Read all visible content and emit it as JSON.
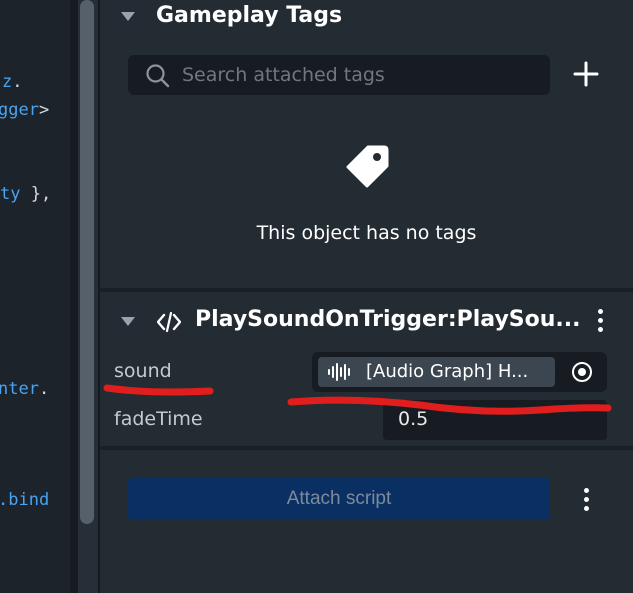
{
  "code": {
    "lines": [
      {
        "blue": "z",
        "white": "."
      },
      {
        "blue": "gger",
        "white": ">"
      },
      {
        "blue": "ty",
        "white": " },"
      },
      {
        "blue": "nter",
        "white": "."
      },
      {
        "blue": ".bind",
        "white": ""
      }
    ]
  },
  "gameplay_tags": {
    "title": "Gameplay Tags",
    "search_placeholder": "Search attached tags",
    "empty_message": "This object has no tags"
  },
  "component": {
    "title": "PlaySoundOnTrigger:PlaySou...",
    "properties": [
      {
        "label": "sound",
        "value": "[Audio Graph] H..."
      },
      {
        "label": "fadeTime",
        "value": "0.5"
      }
    ]
  },
  "attach_script_label": "Attach script",
  "colors": {
    "panel_bg": "#232b33",
    "field_bg": "#161c22",
    "attach_button_bg": "#0a2f63",
    "annotation_red": "#e01e1e",
    "code_blue": "#4aa3f0"
  }
}
